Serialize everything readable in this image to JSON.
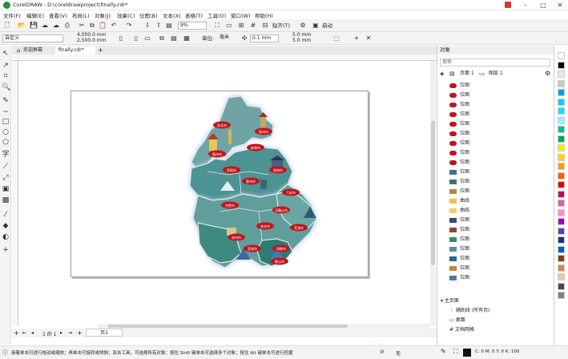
{
  "app": {
    "title": "CorelDRAW - D:\\coreldrawproject\\finally.cdr*",
    "menu": [
      "文件(F)",
      "编辑(E)",
      "查看(V)",
      "布局(L)",
      "对象(J)",
      "效果(C)",
      "位图(B)",
      "文本(X)",
      "表格(T)",
      "工具(O)",
      "窗口(W)",
      "帮助(H)"
    ]
  },
  "toolbar": {
    "zoom": "9%",
    "snap": "贴齐(T)",
    "launch": "启动"
  },
  "propbar": {
    "preset": "自定义",
    "width": "4,000.0 mm",
    "height": "2,500.0 mm",
    "units_label": "单位:",
    "units": "毫米",
    "nudge": "0.1 mm",
    "dup_x": "5.0 mm",
    "dup_y": "5.0 mm"
  },
  "tabs": [
    "欢迎屏幕",
    "finally.cdr*"
  ],
  "pagebar": {
    "counter": "1 的 1",
    "page": "页1"
  },
  "status": {
    "hint": "接着单击可进行拖动或缩放；再单击可旋转或倾斜；双击工具，可选择所有对象；按住 Shift 键单击可选择多个对象；按住 Alt 键单击可进行挖掘",
    "fill": "无",
    "color_info": "C: 0 M: 0 Y: 0 K: 100"
  },
  "objects_panel": {
    "title": "对象",
    "search_placeholder": "搜索",
    "page_tab": "页面 1",
    "layer_tab": "图层 1",
    "items": [
      {
        "label": "位图",
        "icon": "red-banner-icon"
      },
      {
        "label": "位图",
        "icon": "red-banner-icon"
      },
      {
        "label": "位图",
        "icon": "red-banner-icon"
      },
      {
        "label": "位图",
        "icon": "red-banner-icon"
      },
      {
        "label": "位图",
        "icon": "red-banner-icon"
      },
      {
        "label": "位图",
        "icon": "red-banner-icon"
      },
      {
        "label": "位图",
        "icon": "red-banner-icon"
      },
      {
        "label": "位图",
        "icon": "red-banner-icon"
      },
      {
        "label": "位图",
        "icon": "red-banner-icon"
      },
      {
        "label": "位图",
        "icon": "landmark-icon"
      },
      {
        "label": "位图",
        "icon": "tree-icon"
      },
      {
        "label": "位图",
        "icon": "temple-icon"
      },
      {
        "label": "曲线",
        "icon": "curve-icon"
      },
      {
        "label": "曲线",
        "icon": "curve-icon"
      },
      {
        "label": "位图",
        "icon": "pavilion-icon"
      },
      {
        "label": "位图",
        "icon": "tower-icon"
      },
      {
        "label": "位图",
        "icon": "palm-icon"
      },
      {
        "label": "位图",
        "icon": "mountain-icon"
      },
      {
        "label": "位图",
        "icon": "mountain-icon"
      },
      {
        "label": "位图",
        "icon": "pagoda-icon"
      },
      {
        "label": "位图",
        "icon": "boat-icon"
      }
    ],
    "master_page": "主页面",
    "master_items": [
      "辅助线 (所有页)",
      "桌面",
      "文档网格"
    ]
  },
  "map": {
    "city_labels": [
      "淮北市",
      "宿州市",
      "亳州市",
      "蚌埠市",
      "阜阳市",
      "淮南市",
      "滁州市",
      "六安市",
      "合肥市",
      "马鞍山市",
      "芜湖市",
      "安庆市",
      "池州市",
      "铜陵市",
      "宣城市",
      "黄山市"
    ]
  },
  "palette": [
    "#ffffff",
    "#000000",
    "#e8e8e8",
    "#c8c8c8",
    "#00a0e9",
    "#00d0ff",
    "#10e0ff",
    "#a0f0ff",
    "#00c08a",
    "#00a850",
    "#f0f000",
    "#ffd200",
    "#ff9a00",
    "#ff5a00",
    "#e00000",
    "#c00060",
    "#e060a0",
    "#ff8ad0",
    "#a000c0",
    "#6040a0",
    "#203080",
    "#0060c0",
    "#804020",
    "#c09060",
    "#f0c8a0",
    "#4a4a4a",
    "#808080"
  ]
}
